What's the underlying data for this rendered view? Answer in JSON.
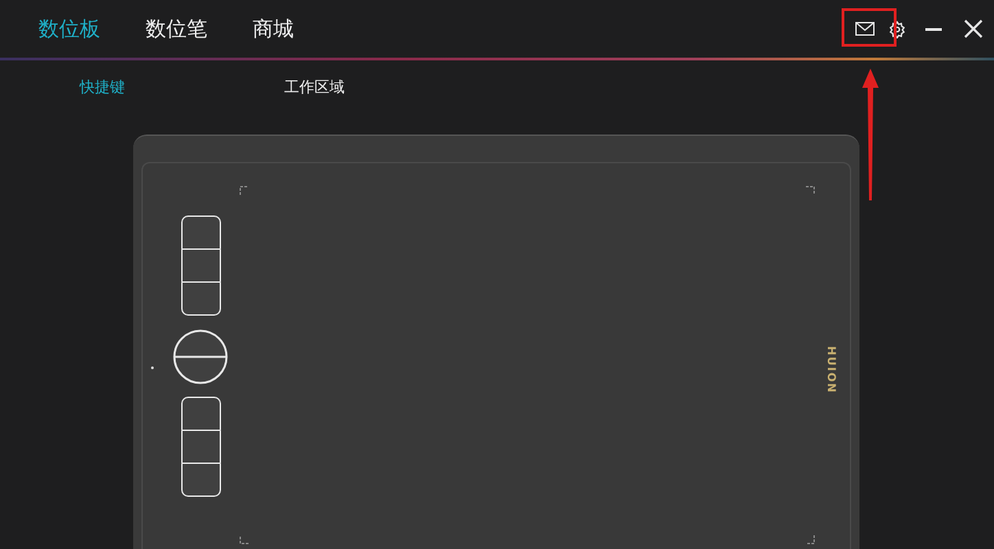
{
  "tabs": [
    {
      "label": "数位板",
      "selected": true
    },
    {
      "label": "数位笔",
      "selected": false
    },
    {
      "label": "商城",
      "selected": false
    }
  ],
  "sub_tabs": [
    {
      "label": "快捷键",
      "selected": true
    },
    {
      "label": "工作区域",
      "selected": false
    }
  ],
  "tablet": {
    "brand": "HUION"
  }
}
